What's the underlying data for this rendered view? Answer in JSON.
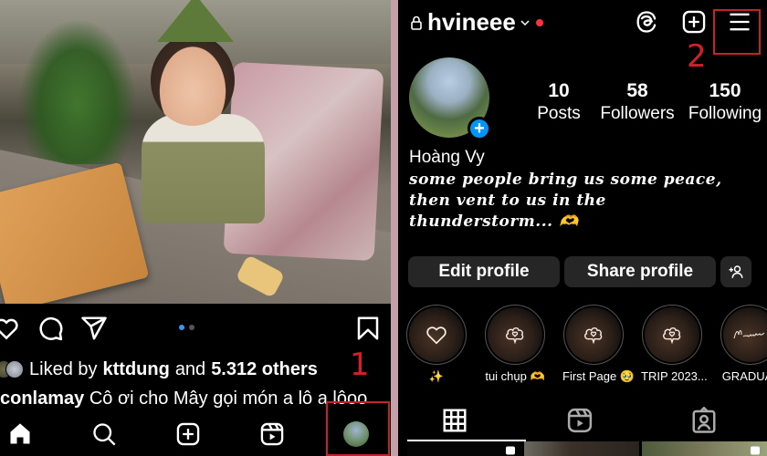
{
  "feed_post": {
    "photo_alt": "Toddler wearing a leaf hat sitting at a wooden table",
    "carousel": {
      "total": 2,
      "active": 1
    },
    "likes": {
      "prefix": "Liked by",
      "user": "kttdung",
      "conjunction": "and",
      "count": "5.312 others"
    },
    "caption": {
      "username": "conlamay",
      "text": "Cô ơi cho Mây gọi món a lô a lôoo"
    },
    "icons": {
      "like": "heart-icon",
      "comment": "comment-icon",
      "share": "paper-plane-icon",
      "save": "bookmark-icon"
    },
    "bottom_nav": [
      "home",
      "search",
      "create",
      "reels",
      "profile"
    ]
  },
  "annotations": {
    "step1": "1",
    "step2": "2",
    "color": "#c8202a"
  },
  "profile": {
    "username": "hvineee",
    "fullname": "Hoàng Vy",
    "bio_lines": [
      "some people bring us some peace,",
      "then vent to us in the",
      "thunderstorm... 🫶"
    ],
    "stats": [
      {
        "value": "10",
        "label": "Posts"
      },
      {
        "value": "58",
        "label": "Followers"
      },
      {
        "value": "150",
        "label": "Following"
      }
    ],
    "buttons": {
      "edit": "Edit profile",
      "share": "Share profile"
    },
    "highlights": [
      {
        "label": "✨",
        "icon": "heart"
      },
      {
        "label": "tui chụp 🫶",
        "icon": "cloud-heart"
      },
      {
        "label": "First Page 🥹",
        "icon": "cloud-heart"
      },
      {
        "label": "TRIP 2023...",
        "icon": "cloud-heart"
      },
      {
        "label": "GRADUAT",
        "icon": "memories-text"
      }
    ],
    "tabs": [
      "grid",
      "reels",
      "tagged"
    ],
    "active_tab": "grid",
    "accent": "#0095f6",
    "notification_dot": "#ff3040"
  }
}
